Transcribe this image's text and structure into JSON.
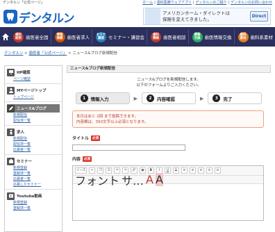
{
  "topbar": {
    "site_name": "デンタルン「公式ページ」",
    "links": [
      "ホーム",
      "歯科医療ウェブアプリ",
      "デンタルンのご紹介",
      "デンタルンのお問い合わせ"
    ]
  },
  "header": {
    "brand": "デンタルン",
    "ad": {
      "text": "アメリカンホーム・ダイレクトは\n保険を変えてきました。",
      "badge": "Direct"
    }
  },
  "nav": {
    "items": [
      {
        "icon": "歯科\n医院",
        "label": "歯医者全国",
        "color": "#c0392b"
      },
      {
        "icon": "情報\n掲載",
        "label": "歯医者求人",
        "color": "#d35400"
      },
      {
        "icon": "セミナ\n講習",
        "label": "セミナー・講習会",
        "color": "#2980b9"
      },
      {
        "icon": "歯科\n情報",
        "label": "歯医者相談",
        "color": "#c0392b"
      },
      {
        "icon": "情報\n交換",
        "label": "歯医情報交換",
        "color": "#27ae60"
      },
      {
        "icon": "歯科\n素材",
        "label": "歯科系素材",
        "color": "#e67e22"
      }
    ]
  },
  "breadcrumb": {
    "home": "デンタルン",
    "parent": "歯医者「公式ページ」",
    "current": "ニュース&ブログ新規配信"
  },
  "sidebar": {
    "sections": [
      {
        "title": "HP確認",
        "links": [
          "ページ確認"
        ]
      },
      {
        "title": "MYページトップ",
        "links": [
          "トップページ"
        ]
      },
      {
        "title": "ニュース&ブログ",
        "links": [
          "新規配信",
          "配信済一覧"
        ],
        "active": true
      },
      {
        "title": "求人",
        "links": [
          "新規配信",
          "配信済一覧",
          "応募者一覧"
        ]
      },
      {
        "title": "セミナー",
        "links": [
          "新規登録",
          "登録済一覧",
          "応募者一覧",
          "応募したセミナー"
        ]
      },
      {
        "title": "Youtube動画",
        "links": [
          "新規登録",
          "登録済一覧"
        ]
      }
    ]
  },
  "main": {
    "title": "ニュース&ブログ新規配信",
    "intro1": "ニュース&ブログを新規配信します。",
    "intro2": "以下のフォームよりご入力ください。",
    "steps": [
      {
        "num": "1",
        "label": "情報入力"
      },
      {
        "num": "2",
        "label": "内容確認"
      },
      {
        "num": "3",
        "label": "完了"
      }
    ],
    "notice_line1": "本日はあと 2回 まで投稿できます。",
    "notice_line2": "内容欄は、350文字以上必須となります。",
    "title_label": "タイトル",
    "content_label": "内容",
    "required": "必須",
    "toolbar": {
      "source": "ソース",
      "bold": "B",
      "italic": "I",
      "underline": "U",
      "strike": "S",
      "font": "フォント",
      "size": "サ…"
    }
  }
}
